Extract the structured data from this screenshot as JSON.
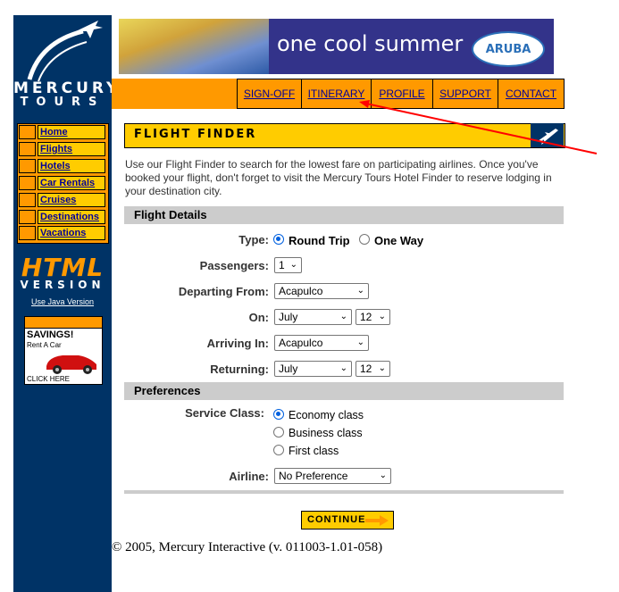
{
  "brand": {
    "logo_line1": "MERCURY",
    "logo_line2": "TOURS",
    "html_version_big": "HTML",
    "html_version_small": "VERSION",
    "java_link": "Use Java Version"
  },
  "banner": {
    "text": "one cool summer",
    "badge": "ARUBA"
  },
  "top_nav": [
    {
      "label": "SIGN-OFF"
    },
    {
      "label": "ITINERARY"
    },
    {
      "label": "PROFILE"
    },
    {
      "label": "SUPPORT"
    },
    {
      "label": "CONTACT"
    }
  ],
  "side_nav": [
    {
      "label": "Home"
    },
    {
      "label": "Flights"
    },
    {
      "label": "Hotels"
    },
    {
      "label": "Car Rentals"
    },
    {
      "label": "Cruises"
    },
    {
      "label": "Destinations"
    },
    {
      "label": "Vacations"
    }
  ],
  "ad": {
    "title": "SAVINGS!",
    "subtitle": "Rent A Car",
    "cta": "CLICK HERE"
  },
  "page": {
    "title": "FLIGHT FINDER",
    "intro": "Use our Flight Finder to search for the lowest fare on participating airlines. Once you've booked your flight, don't forget to visit the Mercury Tours Hotel Finder to reserve lodging in your destination city."
  },
  "flight_details": {
    "section_title": "Flight Details",
    "type_label": "Type:",
    "type_options": [
      "Round Trip",
      "One Way"
    ],
    "type_selected": "Round Trip",
    "passengers_label": "Passengers:",
    "passengers_value": "1",
    "departing_label": "Departing From:",
    "departing_value": "Acapulco",
    "on_label": "On:",
    "on_month": "July",
    "on_day": "12",
    "arriving_label": "Arriving In:",
    "arriving_value": "Acapulco",
    "returning_label": "Returning:",
    "returning_month": "July",
    "returning_day": "12"
  },
  "preferences": {
    "section_title": "Preferences",
    "service_label": "Service Class:",
    "service_options": [
      "Economy class",
      "Business class",
      "First class"
    ],
    "service_selected": "Economy class",
    "airline_label": "Airline:",
    "airline_value": "No Preference"
  },
  "continue_label": "CONTINUE",
  "copyright": "© 2005, Mercury Interactive (v. 011003-1.01-058)",
  "colors": {
    "navy": "#003366",
    "orange": "#ff9900",
    "yellow": "#ffcc00",
    "section_gray": "#cccccc",
    "link_blue": "#000099",
    "annotation_red": "#ff0000"
  }
}
